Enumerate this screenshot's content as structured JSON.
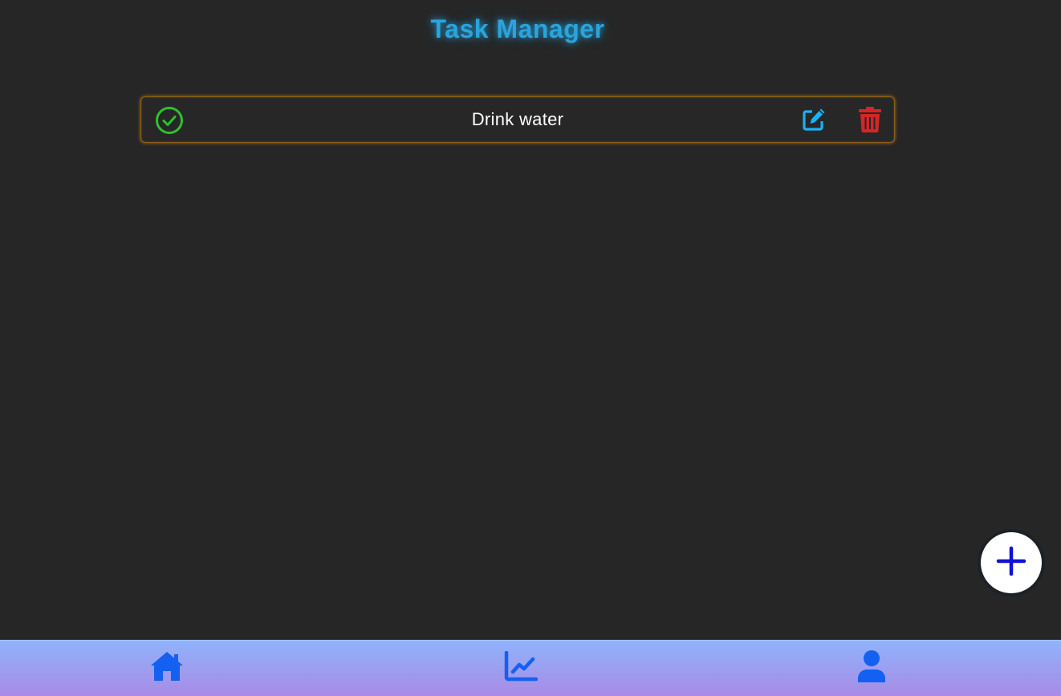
{
  "header": {
    "title": "Task Manager"
  },
  "tasks": [
    {
      "text": "Drink water",
      "completed": true
    }
  ],
  "icons": {
    "check": "check-circle-icon",
    "edit": "edit-icon",
    "delete": "trash-icon",
    "add": "plus-icon",
    "nav_home": "home-icon",
    "nav_stats": "chart-line-icon",
    "nav_profile": "user-icon"
  },
  "colors": {
    "title": "#2aa4dd",
    "check": "#2ec02e",
    "edit": "#1ab2f2",
    "delete": "#d42626",
    "plus": "#1010d8",
    "nav_icon": "#1460f0",
    "task_border": "#8a5e12"
  }
}
